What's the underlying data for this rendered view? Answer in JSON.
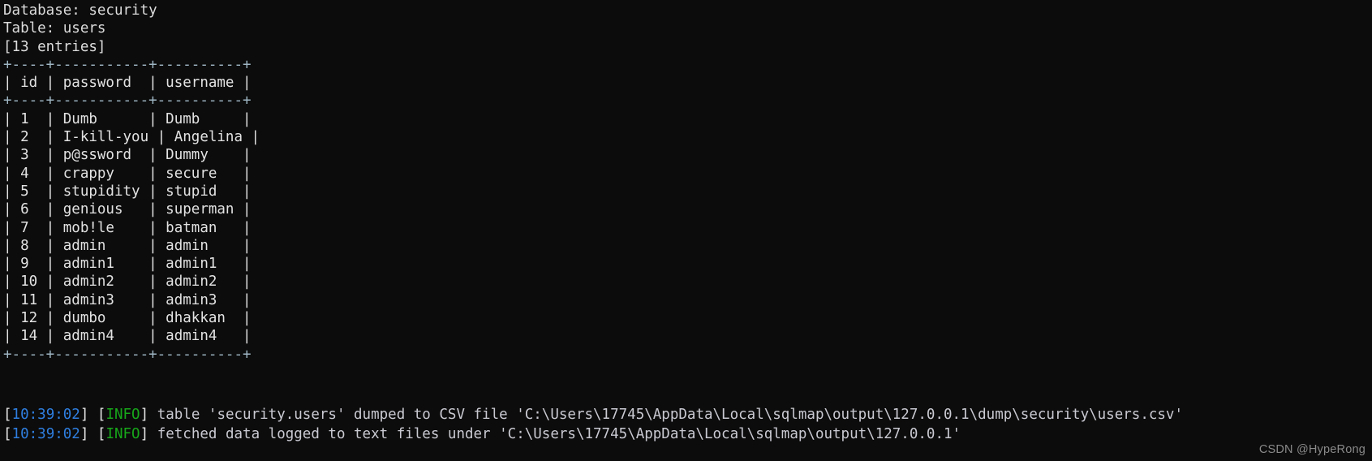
{
  "terminal": {
    "background": "#0c0c0c",
    "header": {
      "database_line": "Database: security",
      "table_line": "Table: users",
      "entries_line": "[13 entries]"
    },
    "table": {
      "rule": "+----+-----------+----------+",
      "header_row": "| id | password  | username |",
      "columns": [
        "id",
        "password",
        "username"
      ],
      "rows": [
        {
          "id": "1",
          "password": "Dumb",
          "username": "Dumb"
        },
        {
          "id": "2",
          "password": "I-kill-you",
          "username": "Angelina"
        },
        {
          "id": "3",
          "password": "p@ssword",
          "username": "Dummy"
        },
        {
          "id": "4",
          "password": "crappy",
          "username": "secure"
        },
        {
          "id": "5",
          "password": "stupidity",
          "username": "stupid"
        },
        {
          "id": "6",
          "password": "genious",
          "username": "superman"
        },
        {
          "id": "7",
          "password": "mob!le",
          "username": "batman"
        },
        {
          "id": "8",
          "password": "admin",
          "username": "admin"
        },
        {
          "id": "9",
          "password": "admin1",
          "username": "admin1"
        },
        {
          "id": "10",
          "password": "admin2",
          "username": "admin2"
        },
        {
          "id": "11",
          "password": "admin3",
          "username": "admin3"
        },
        {
          "id": "12",
          "password": "dumbo",
          "username": "dhakkan"
        },
        {
          "id": "14",
          "password": "admin4",
          "username": "admin4"
        }
      ],
      "row_lines": [
        "| 1  | Dumb      | Dumb     |",
        "| 2  | I-kill-you | Angelina |",
        "| 3  | p@ssword  | Dummy    |",
        "| 4  | crappy    | secure   |",
        "| 5  | stupidity | stupid   |",
        "| 6  | genious   | superman |",
        "| 7  | mob!le    | batman   |",
        "| 8  | admin     | admin    |",
        "| 9  | admin1    | admin1   |",
        "| 10 | admin2    | admin2   |",
        "| 11 | admin3    | admin3   |",
        "| 12 | dumbo     | dhakkan  |",
        "| 14 | admin4    | admin4   |"
      ]
    },
    "log": [
      {
        "timestamp": "10:39:02",
        "level": "INFO",
        "message": "table 'security.users' dumped to CSV file 'C:\\Users\\17745\\AppData\\Local\\sqlmap\\output\\127.0.0.1\\dump\\security\\users.csv'"
      },
      {
        "timestamp": "10:39:02",
        "level": "INFO",
        "message": "fetched data logged to text files under 'C:\\Users\\17745\\AppData\\Local\\sqlmap\\output\\127.0.0.1'"
      }
    ],
    "watermark": "CSDN @HypeRong"
  }
}
